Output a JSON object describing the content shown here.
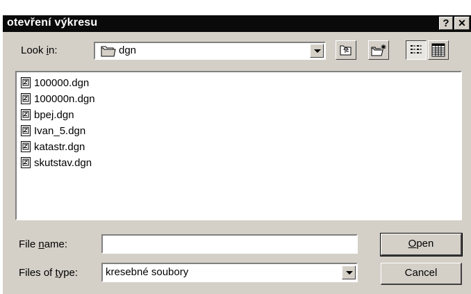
{
  "window": {
    "title": "otevření výkresu",
    "help_label": "?",
    "close_label": "✕"
  },
  "look_in": {
    "label_pre": "Look ",
    "label_ul": "i",
    "label_post": "n:",
    "value": "dgn",
    "icon": "folder-icon"
  },
  "toolbar": {
    "buttons": [
      "up-one-level-icon",
      "create-new-folder-icon",
      "list-view-icon",
      "details-view-icon"
    ]
  },
  "files": [
    {
      "name": "100000.dgn",
      "icon": "dgn-file-icon"
    },
    {
      "name": "100000n.dgn",
      "icon": "dgn-file-icon"
    },
    {
      "name": "bpej.dgn",
      "icon": "dgn-file-icon"
    },
    {
      "name": "Ivan_5.dgn",
      "icon": "dgn-file-icon"
    },
    {
      "name": "katastr.dgn",
      "icon": "dgn-file-icon"
    },
    {
      "name": "skutstav.dgn",
      "icon": "dgn-file-icon"
    }
  ],
  "file_name": {
    "label_pre": "File ",
    "label_ul": "n",
    "label_post": "ame:",
    "value": ""
  },
  "file_type": {
    "label_pre": "Files of ",
    "label_ul": "t",
    "label_post": "ype:",
    "value": "kresebné soubory"
  },
  "buttons": {
    "open_ul": "O",
    "open_rest": "pen",
    "cancel": "Cancel"
  },
  "colors": {
    "dialog_bg": "#d4d0c8",
    "titlebar_bg": "#0a0a0a"
  }
}
